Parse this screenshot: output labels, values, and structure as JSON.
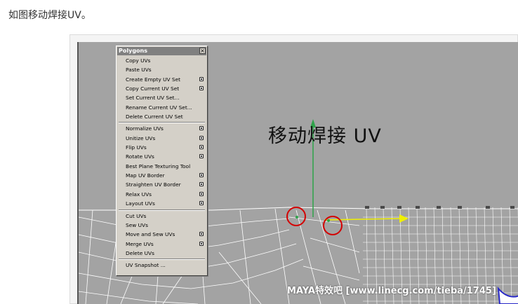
{
  "article": {
    "intro_text": "如图移动焊接UV。"
  },
  "viewport": {
    "overlay_title": "移动焊接 UV",
    "watermark": "MAYA特效吧 [www.linecg.com/tieba/1745]",
    "colors": {
      "background": "#a3a3a3",
      "wire": "#ffffff",
      "highlight_circles": "#d40000",
      "y_axis": "#2ea34a",
      "x_axis": "#f0f000"
    }
  },
  "polygons_menu": {
    "title": "Polygons",
    "close_label": "×",
    "groups": [
      [
        {
          "label": "Copy UVs",
          "has_options": false
        },
        {
          "label": "Paste UVs",
          "has_options": false
        },
        {
          "label": "Create Empty UV Set",
          "has_options": true
        },
        {
          "label": "Copy Current UV Set",
          "has_options": true
        },
        {
          "label": "Set Current UV Set...",
          "has_options": false
        },
        {
          "label": "Rename Current UV Set...",
          "has_options": false
        },
        {
          "label": "Delete Current UV Set",
          "has_options": false
        }
      ],
      [
        {
          "label": "Normalize UVs",
          "has_options": true
        },
        {
          "label": "Unitize UVs",
          "has_options": true
        },
        {
          "label": "Flip UVs",
          "has_options": true
        },
        {
          "label": "Rotate UVs",
          "has_options": true
        },
        {
          "label": "Best Plane Texturing Tool",
          "has_options": false
        },
        {
          "label": "Map UV Border",
          "has_options": true
        },
        {
          "label": "Straighten UV Border",
          "has_options": true
        },
        {
          "label": "Relax UVs",
          "has_options": true
        },
        {
          "label": "Layout UVs",
          "has_options": true
        }
      ],
      [
        {
          "label": "Cut UVs",
          "has_options": false
        },
        {
          "label": "Sew UVs",
          "has_options": false
        },
        {
          "label": "Move and Sew UVs",
          "has_options": true
        },
        {
          "label": "Merge UVs",
          "has_options": true
        },
        {
          "label": "Delete UVs",
          "has_options": false
        }
      ],
      [
        {
          "label": "UV Snapshot ...",
          "has_options": false
        }
      ]
    ]
  }
}
